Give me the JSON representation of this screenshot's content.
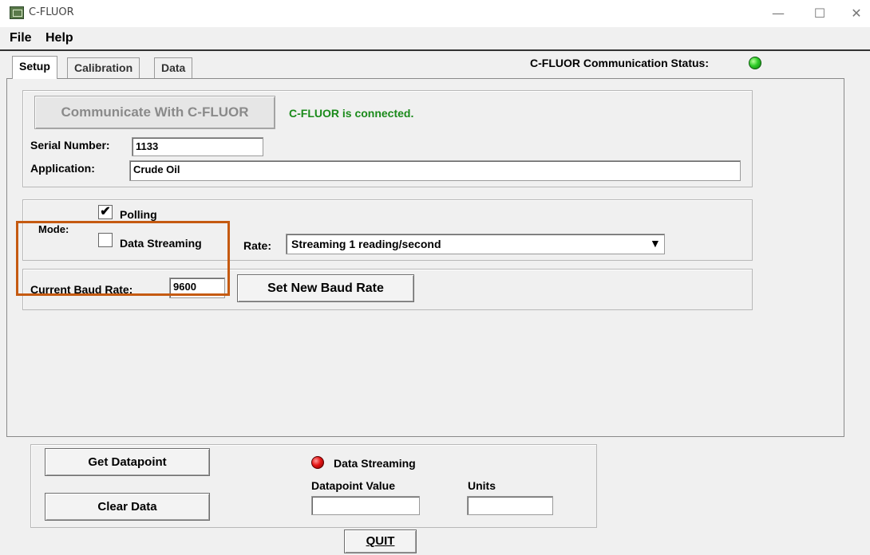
{
  "window": {
    "title": "C-FLUOR",
    "controls": {
      "minimize": "—",
      "maximize": "☐",
      "close": "✕"
    }
  },
  "menu": {
    "file": "File",
    "help": "Help"
  },
  "tabs": [
    {
      "label": "Setup",
      "active": true
    },
    {
      "label": "Calibration",
      "active": false
    },
    {
      "label": "Data",
      "active": false
    }
  ],
  "comm_status": {
    "label": "C-FLUOR Communication Status:",
    "color": "#2ecc28"
  },
  "connection": {
    "button_label": "Communicate With C-FLUOR",
    "status_text": "C-FLUOR is connected.",
    "status_color": "#1a8a1a"
  },
  "serial": {
    "label": "Serial Number:",
    "value": "1133"
  },
  "application": {
    "label": "Application:",
    "value": "Crude Oil"
  },
  "mode": {
    "label": "Mode:",
    "polling": {
      "label": "Polling",
      "checked": true,
      "mark": "✔"
    },
    "streaming": {
      "label": "Data Streaming",
      "checked": false
    }
  },
  "rate": {
    "label": "Rate:",
    "selected": "Streaming 1 reading/second",
    "arrow": "▼"
  },
  "baud": {
    "label": "Current Baud Rate:",
    "value": "9600",
    "button_label": "Set New Baud Rate"
  },
  "bottom": {
    "get_datapoint": "Get Datapoint",
    "clear_data": "Clear Data",
    "streaming_indicator": {
      "label": "Data Streaming",
      "color": "#e51515"
    },
    "datapoint_value_label": "Datapoint Value",
    "datapoint_value": "",
    "units_label": "Units",
    "units_value": "",
    "quit_label": "QUIT"
  },
  "highlight_color": "#c55a11"
}
